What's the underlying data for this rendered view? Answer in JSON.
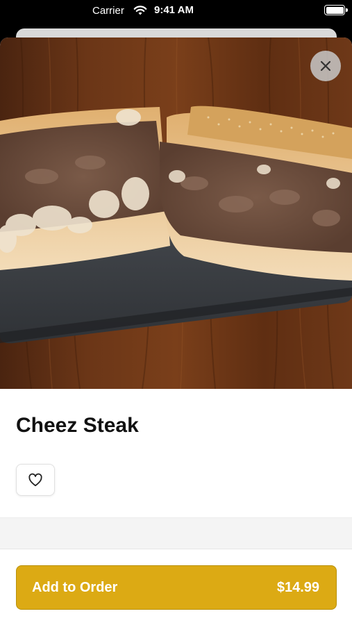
{
  "status_bar": {
    "carrier": "Carrier",
    "time": "9:41 AM"
  },
  "item": {
    "name": "Cheez Steak",
    "image_alt": "cheesesteak sandwich on a dark tray"
  },
  "order_button": {
    "label": "Add to Order",
    "price": "$14.99"
  },
  "icons": {
    "close": "close-icon",
    "favorite": "heart-icon",
    "wifi": "wifi-icon",
    "battery": "battery-icon"
  },
  "colors": {
    "accent": "#dcaa14",
    "title": "#111111"
  }
}
